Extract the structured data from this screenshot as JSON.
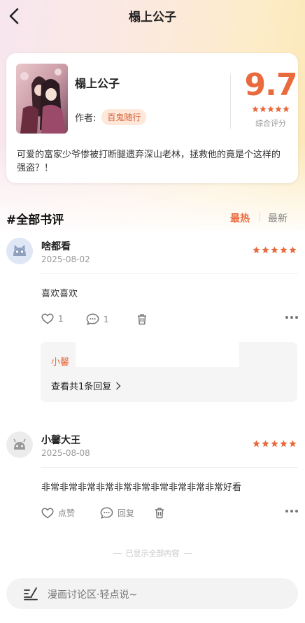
{
  "header": {
    "title": "榻上公子"
  },
  "book": {
    "title": "榻上公子",
    "author_label": "作者:",
    "author_name": "百鬼随行",
    "score": "9.7",
    "score_label": "综合评分",
    "score_stars": 5,
    "summary": "可爱的富家少爷惨被打断腿遗弃深山老林，拯救他的竟是个这样的强盗？！"
  },
  "reviews_section": {
    "title": "#全部书评",
    "sort_hot": "最热",
    "sort_new": "最新"
  },
  "reviews": [
    {
      "name": "啥都看",
      "date": "2025-08-02",
      "rating": 5,
      "text": "喜欢喜欢",
      "like": "1",
      "comment": "1",
      "reply_preview_user": "小馨",
      "reply_more": "查看共1条回复"
    },
    {
      "name": "小馨大王",
      "date": "2025-08-08",
      "rating": 5,
      "text": "非常非常非常非常非常非常非常非常非常非常好看",
      "like": "点赞",
      "comment": "回复"
    }
  ],
  "end_note": "已显示全部内容",
  "bottom_input": {
    "placeholder": "漫画讨论区·轻点说~"
  },
  "colors": {
    "accent": "#e86a3d",
    "author_bg": "#fde8d9",
    "star": "#e86a3d"
  }
}
